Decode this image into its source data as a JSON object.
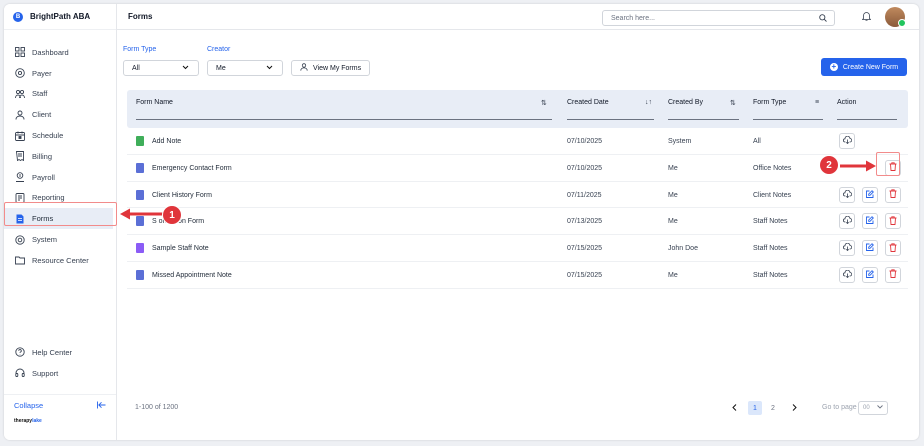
{
  "app": {
    "brand_name": "BrightPath ABA",
    "brand_initial": "B",
    "page_title": "Forms"
  },
  "header": {
    "search_placeholder": "Search here...",
    "search_icon": "search-icon",
    "bell_icon": "bell-icon"
  },
  "sidebar": {
    "items": [
      {
        "label": "Dashboard",
        "icon": "grid-icon"
      },
      {
        "label": "Payer",
        "icon": "payer-icon"
      },
      {
        "label": "Staff",
        "icon": "staff-icon"
      },
      {
        "label": "Client",
        "icon": "client-icon"
      },
      {
        "label": "Schedule",
        "icon": "calendar-icon"
      },
      {
        "label": "Billing",
        "icon": "billing-icon"
      },
      {
        "label": "Payroll",
        "icon": "payroll-icon"
      },
      {
        "label": "Reporting",
        "icon": "reporting-icon"
      },
      {
        "label": "Forms",
        "icon": "forms-icon",
        "active": true
      },
      {
        "label": "System",
        "icon": "system-icon"
      },
      {
        "label": "Resource Center",
        "icon": "folder-icon"
      }
    ],
    "bottom_items": [
      {
        "label": "Help Center",
        "icon": "help-icon"
      },
      {
        "label": "Support",
        "icon": "headset-icon"
      }
    ],
    "collapse_label": "Collapse",
    "powered_by_prefix": "therapy",
    "powered_by_suffix": "lake"
  },
  "filters": {
    "form_type_label": "Form Type",
    "form_type_value": "All",
    "creator_label": "Creator",
    "creator_value": "Me",
    "view_my_forms_label": "View My Forms",
    "create_new_form_label": "Create New Form"
  },
  "table": {
    "columns": [
      "Form Name",
      "Created Date",
      "Created By",
      "Form Type",
      "Action"
    ],
    "rows": [
      {
        "name": "Add Note",
        "date": "07/10/2025",
        "by": "System",
        "type": "All",
        "icon_color": "#3fae5a",
        "actions": [
          "download"
        ]
      },
      {
        "name": "Emergency Contact Form",
        "date": "07/10/2025",
        "by": "Me",
        "type": "Office Notes",
        "icon_color": "#5b6fd6",
        "actions": [
          "delete"
        ]
      },
      {
        "name": "Client History Form",
        "date": "07/11/2025",
        "by": "Me",
        "type": "Client Notes",
        "icon_color": "#5b6fd6",
        "actions": [
          "download",
          "edit",
          "delete"
        ]
      },
      {
        "name": "S ormation Form",
        "date": "07/13/2025",
        "by": "Me",
        "type": "Staff Notes",
        "icon_color": "#5b6fd6",
        "actions": [
          "download",
          "edit",
          "delete"
        ]
      },
      {
        "name": "Sample Staff Note",
        "date": "07/15/2025",
        "by": "John Doe",
        "type": "Staff Notes",
        "icon_color": "#8b5cf6",
        "actions": [
          "download",
          "edit",
          "delete"
        ]
      },
      {
        "name": "Missed Appointment Note",
        "date": "07/15/2025",
        "by": "Me",
        "type": "Staff Notes",
        "icon_color": "#5b6fd6",
        "actions": [
          "download",
          "edit",
          "delete"
        ]
      }
    ]
  },
  "pagination": {
    "range_text": "1-100 of 1200",
    "pages": [
      "1",
      "2"
    ],
    "current_page": "1",
    "goto_label": "Go to page",
    "goto_value": "00"
  },
  "annotations": {
    "step1": "1",
    "step2": "2"
  },
  "colors": {
    "accent": "#2563eb",
    "danger": "#e0353b",
    "header_bg": "#e8edf6"
  }
}
